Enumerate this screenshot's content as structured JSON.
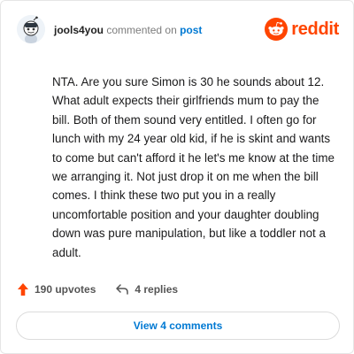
{
  "comment": {
    "username": "jools4you",
    "action_text": "commented on",
    "target_link": "post",
    "body": "NTA. Are you sure Simon is 30 he sounds about 12. What adult expects their girlfriends mum to pay the bill. Both of them sound very entitled. I often go for lunch with my 24 year old kid, if he is skint and wants to come but can't afford it he let's me know at the time we arranging it. Not just drop it on me when the bill comes. I think these two put you in a really uncomfortable position and your daughter doubling down was pure manipulation, but like a toddler not a adult.",
    "upvotes_label": "190 upvotes",
    "replies_label": "4 replies",
    "view_comments_label": "View 4 comments"
  },
  "brand": {
    "name": "reddit",
    "icon": "reddit-snoo-icon",
    "color": "#ff4500"
  },
  "icons": {
    "avatar": "snoo-avatar-icon",
    "upvote": "upvote-arrow-icon",
    "reply": "reply-arrow-icon"
  },
  "colors": {
    "accent": "#0079d3",
    "upvote": "#ff4500"
  }
}
